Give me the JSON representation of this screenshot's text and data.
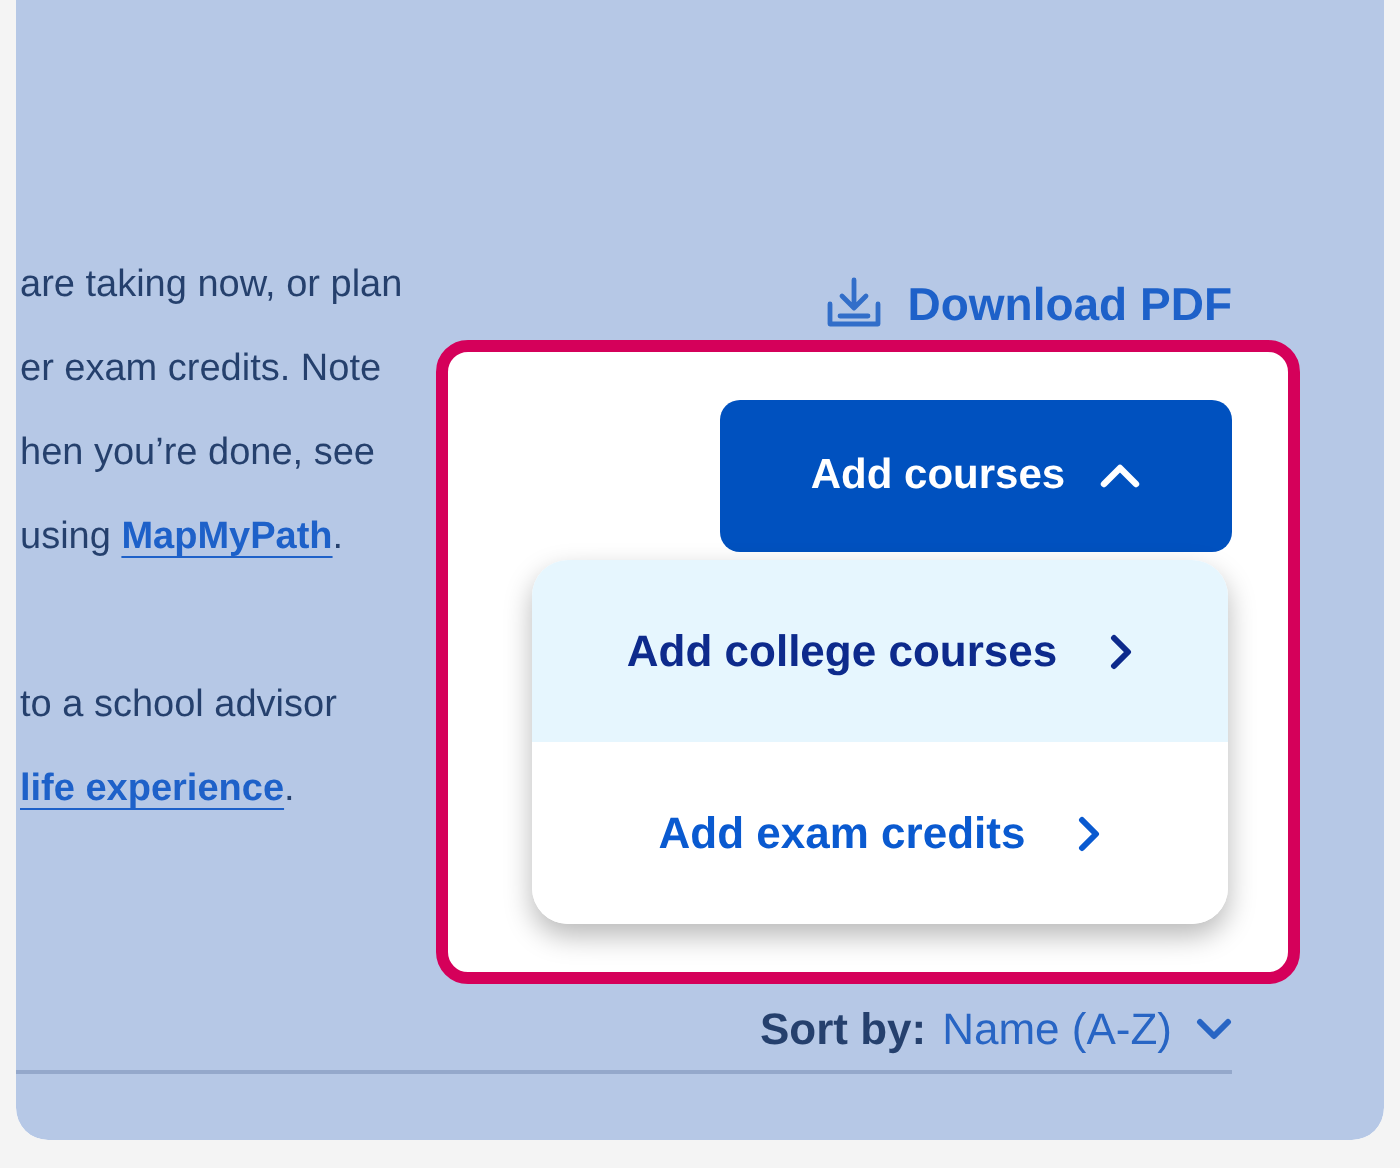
{
  "paragraphs": [
    {
      "lines": [
        {
          "text": "are taking now, or plan"
        },
        {
          "text": "er exam credits. Note"
        },
        {
          "text": "hen you’re done, see"
        },
        {
          "text": "using ",
          "link": "MapMyPath",
          "after": "."
        }
      ]
    },
    {
      "lines": [
        {
          "text": "to a school advisor"
        },
        {
          "link": "life experience",
          "after": "."
        }
      ]
    }
  ],
  "download": {
    "label": "Download PDF"
  },
  "add_button": {
    "label": "Add courses",
    "expanded": true
  },
  "menu": [
    {
      "label": "Add college courses",
      "selected": true
    },
    {
      "label": "Add exam credits",
      "selected": false
    }
  ],
  "sort": {
    "label": "Sort by:",
    "value": "Name (A-Z)"
  }
}
